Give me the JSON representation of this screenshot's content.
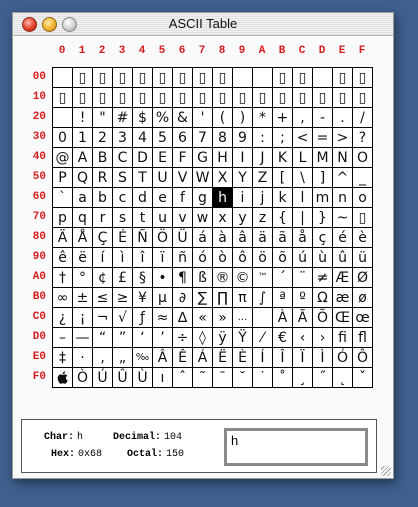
{
  "window": {
    "title": "ASCII Table"
  },
  "columns": [
    "0",
    "1",
    "2",
    "3",
    "4",
    "5",
    "6",
    "7",
    "8",
    "9",
    "A",
    "B",
    "C",
    "D",
    "E",
    "F"
  ],
  "rows": [
    "00",
    "10",
    "20",
    "30",
    "40",
    "50",
    "60",
    "70",
    "80",
    "90",
    "A0",
    "B0",
    "C0",
    "D0",
    "E0",
    "F0"
  ],
  "glyphs": [
    [
      "",
      "▯",
      "▯",
      "▯",
      "▯",
      "▯",
      "▯",
      "▯",
      "▯",
      "",
      "",
      "▯",
      "▯",
      "",
      "▯",
      "▯"
    ],
    [
      "▯",
      "▯",
      "▯",
      "▯",
      "▯",
      "▯",
      "▯",
      "▯",
      "▯",
      "▯",
      "▯",
      "▯",
      "▯",
      "▯",
      "▯",
      "▯"
    ],
    [
      "",
      "!",
      "\"",
      "#",
      "$",
      "%",
      "&",
      "'",
      "(",
      ")",
      "*",
      "+",
      ",",
      "-",
      ".",
      "/"
    ],
    [
      "0",
      "1",
      "2",
      "3",
      "4",
      "5",
      "6",
      "7",
      "8",
      "9",
      ":",
      ";",
      "<",
      "=",
      ">",
      "?"
    ],
    [
      "@",
      "A",
      "B",
      "C",
      "D",
      "E",
      "F",
      "G",
      "H",
      "I",
      "J",
      "K",
      "L",
      "M",
      "N",
      "O"
    ],
    [
      "P",
      "Q",
      "R",
      "S",
      "T",
      "U",
      "V",
      "W",
      "X",
      "Y",
      "Z",
      "[",
      "\\",
      "]",
      "^",
      "_"
    ],
    [
      "`",
      "a",
      "b",
      "c",
      "d",
      "e",
      "f",
      "g",
      "h",
      "i",
      "j",
      "k",
      "l",
      "m",
      "n",
      "o"
    ],
    [
      "p",
      "q",
      "r",
      "s",
      "t",
      "u",
      "v",
      "w",
      "x",
      "y",
      "z",
      "{",
      "|",
      "}",
      "~",
      "▯"
    ],
    [
      "Ä",
      "Å",
      "Ç",
      "É",
      "Ñ",
      "Ö",
      "Ü",
      "á",
      "à",
      "â",
      "ä",
      "ã",
      "å",
      "ç",
      "é",
      "è"
    ],
    [
      "ê",
      "ë",
      "í",
      "ì",
      "î",
      "ï",
      "ñ",
      "ó",
      "ò",
      "ô",
      "ö",
      "õ",
      "ú",
      "ù",
      "û",
      "ü"
    ],
    [
      "†",
      "°",
      "¢",
      "£",
      "§",
      "•",
      "¶",
      "ß",
      "®",
      "©",
      "™",
      "´",
      "¨",
      "≠",
      "Æ",
      "Ø"
    ],
    [
      "∞",
      "±",
      "≤",
      "≥",
      "¥",
      "µ",
      "∂",
      "∑",
      "∏",
      "π",
      "∫",
      "ª",
      "º",
      "Ω",
      "æ",
      "ø"
    ],
    [
      "¿",
      "¡",
      "¬",
      "√",
      "ƒ",
      "≈",
      "∆",
      "«",
      "»",
      "…",
      " ",
      "À",
      "Ã",
      "Õ",
      "Œ",
      "œ"
    ],
    [
      "–",
      "—",
      "“",
      "”",
      "‘",
      "’",
      "÷",
      "◊",
      "ÿ",
      "Ÿ",
      "⁄",
      "€",
      "‹",
      "›",
      "ﬁ",
      "ﬂ"
    ],
    [
      "‡",
      "·",
      "‚",
      "„",
      "‰",
      "Â",
      "Ê",
      "Á",
      "Ë",
      "È",
      "Í",
      "Î",
      "Ï",
      "Ì",
      "Ó",
      "Ô"
    ],
    [
      "",
      "Ò",
      "Ú",
      "Û",
      "Ù",
      "ı",
      "ˆ",
      "˜",
      "¯",
      "˘",
      "˙",
      "˚",
      "¸",
      "˝",
      "˛",
      "ˇ"
    ]
  ],
  "icons": {
    "apple_logo": "apple-logo-icon"
  },
  "selected": {
    "row": 6,
    "col": 8
  },
  "info": {
    "char_label": "Char:",
    "char_value": "h",
    "decimal_label": "Decimal:",
    "decimal_value": "104",
    "hex_label": "Hex:",
    "hex_value": "0x68",
    "octal_label": "Octal:",
    "octal_value": "150",
    "preview_text": "h"
  }
}
